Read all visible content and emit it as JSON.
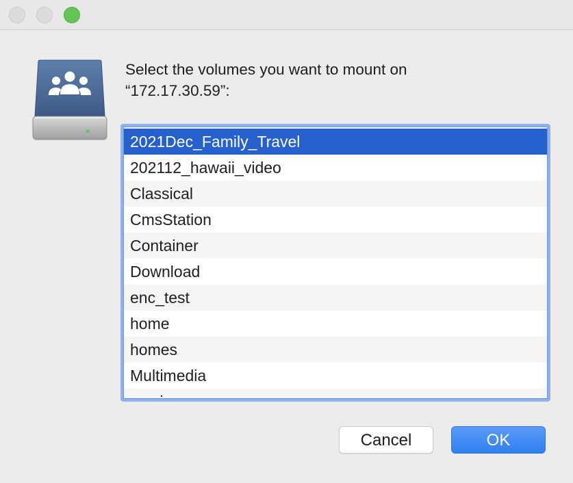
{
  "window": {
    "controls": [
      "close",
      "minimize",
      "zoom"
    ]
  },
  "icon": {
    "name": "network-shared-volume-icon"
  },
  "prompt": {
    "line1": "Select the volumes you want to mount on",
    "line2": "“172.17.30.59”:"
  },
  "volumes": {
    "selected_index": 0,
    "items": [
      "2021Dec_Family_Travel",
      "202112_hawaii_video",
      "Classical",
      "CmsStation",
      "Container",
      "Download",
      "enc_test",
      "home",
      "homes",
      "Multimedia",
      "music"
    ]
  },
  "buttons": {
    "cancel": "Cancel",
    "ok": "OK"
  },
  "colors": {
    "selection": "#2660cc",
    "focus_ring": "#8fb1ee",
    "default_button": "#3a85f4",
    "zoom_button": "#62c554"
  }
}
